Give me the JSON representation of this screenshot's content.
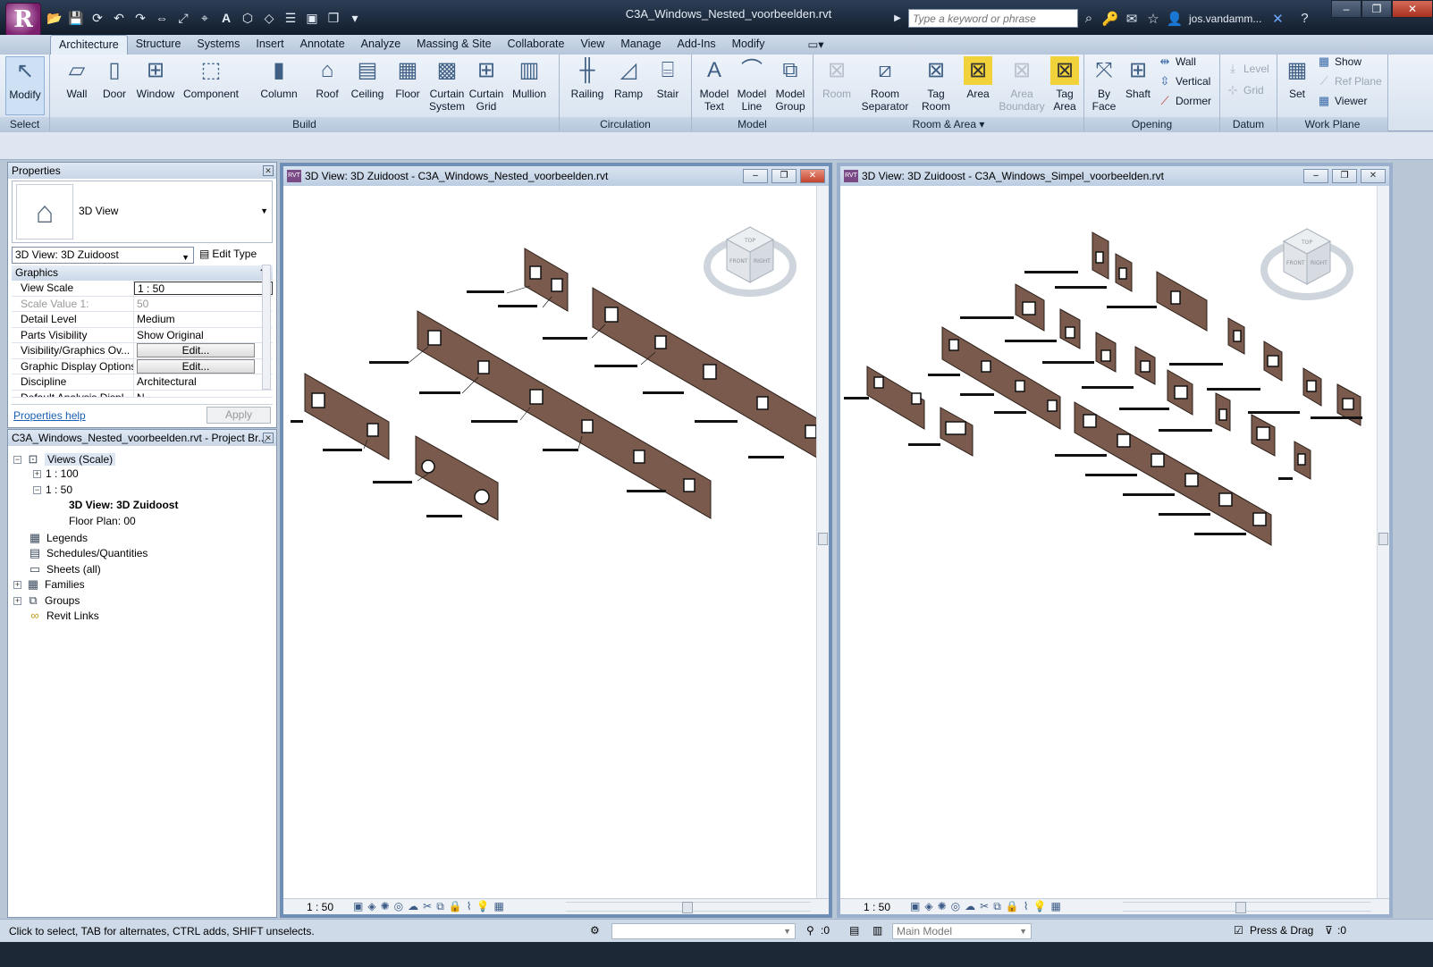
{
  "app": {
    "logo_letter": "R"
  },
  "title": "C3A_Windows_Nested_voorbeelden.rvt",
  "quick_access": [
    "open-icon",
    "save-icon",
    "sync-icon",
    "undo-icon",
    "redo-icon",
    "measure-icon",
    "dimension-icon",
    "tag-icon",
    "text-icon",
    "3d-icon",
    "section-icon",
    "thin-lines-icon",
    "close-hidden-icon",
    "switch-windows-icon",
    "customize-icon"
  ],
  "search": {
    "placeholder": "Type a keyword or phrase"
  },
  "user": {
    "name": "jos.vandamm..."
  },
  "tabs": [
    "Architecture",
    "Structure",
    "Systems",
    "Insert",
    "Annotate",
    "Analyze",
    "Massing & Site",
    "Collaborate",
    "View",
    "Manage",
    "Add-Ins",
    "Modify"
  ],
  "active_tab": "Architecture",
  "ribbon": {
    "select": {
      "title": "Select",
      "modify": "Modify"
    },
    "build": {
      "title": "Build",
      "wall": "Wall",
      "door": "Door",
      "window": "Window",
      "component": "Component",
      "column": "Column",
      "roof": "Roof",
      "ceiling": "Ceiling",
      "floor": "Floor",
      "curtain_system_1": "Curtain",
      "curtain_system_2": "System",
      "curtain_grid_1": "Curtain",
      "curtain_grid_2": "Grid",
      "mullion": "Mullion"
    },
    "circulation": {
      "title": "Circulation",
      "railing": "Railing",
      "ramp": "Ramp",
      "stair": "Stair"
    },
    "model": {
      "title": "Model",
      "model_text_1": "Model",
      "model_text_2": "Text",
      "model_line_1": "Model",
      "model_line_2": "Line",
      "model_group_1": "Model",
      "model_group_2": "Group"
    },
    "room_area": {
      "title": "Room & Area",
      "room": "Room",
      "room_sep_1": "Room",
      "room_sep_2": "Separator",
      "tag_room_1": "Tag",
      "tag_room_2": "Room",
      "area": "Area",
      "area_boundary_1": "Area",
      "area_boundary_2": "Boundary",
      "tag_area_1": "Tag",
      "tag_area_2": "Area"
    },
    "opening": {
      "title": "Opening",
      "by_face_1": "By",
      "by_face_2": "Face",
      "shaft": "Shaft",
      "wall": "Wall",
      "vertical": "Vertical",
      "dormer": "Dormer"
    },
    "datum": {
      "title": "Datum",
      "level": "Level",
      "grid": "Grid"
    },
    "work_plane": {
      "title": "Work Plane",
      "set": "Set",
      "show": "Show",
      "ref_plane": "Ref Plane",
      "viewer": "Viewer"
    }
  },
  "properties": {
    "title": "Properties",
    "type_name": "3D View",
    "view_selector": "3D View: 3D Zuidoost",
    "edit_type": "Edit Type",
    "group": "Graphics",
    "rows": [
      {
        "key": "View Scale",
        "value": "1 : 50"
      },
      {
        "key": "Scale Value    1:",
        "value": "50"
      },
      {
        "key": "Detail Level",
        "value": "Medium"
      },
      {
        "key": "Parts Visibility",
        "value": "Show Original"
      },
      {
        "key": "Visibility/Graphics Ov...",
        "value": "Edit..."
      },
      {
        "key": "Graphic Display Options",
        "value": "Edit..."
      },
      {
        "key": "Discipline",
        "value": "Architectural"
      },
      {
        "key": "Default Analysis Displ...",
        "value": "N..."
      }
    ],
    "help": "Properties help",
    "apply": "Apply"
  },
  "browser": {
    "title": "C3A_Windows_Nested_voorbeelden.rvt - Project Br...",
    "nodes": {
      "views": "Views (Scale)",
      "s100": "1 : 100",
      "s50": "1 : 50",
      "view3d": "3D View: 3D Zuidoost",
      "floor": "Floor Plan: 00",
      "legends": "Legends",
      "schedules": "Schedules/Quantities",
      "sheets": "Sheets (all)",
      "families": "Families",
      "groups": "Groups",
      "links": "Revit Links"
    }
  },
  "views": [
    {
      "title": "3D View: 3D Zuidoost - C3A_Windows_Nested_voorbeelden.rvt",
      "scale": "1 : 50"
    },
    {
      "title": "3D View: 3D Zuidoost - C3A_Windows_Simpel_voorbeelden.rvt",
      "scale": "1 : 50"
    }
  ],
  "viewcube": {
    "top": "TOP",
    "front": "FRONT",
    "right": "RIGHT"
  },
  "status": {
    "hint": "Click to select, TAB for alternates, CTRL adds, SHIFT unselects.",
    "worksets": ":0",
    "model": "Main Model",
    "press_drag": "Press & Drag",
    "filter": ":0"
  },
  "colors": {
    "wall": "#7a5a4c",
    "accent": "#6f8fb6"
  }
}
